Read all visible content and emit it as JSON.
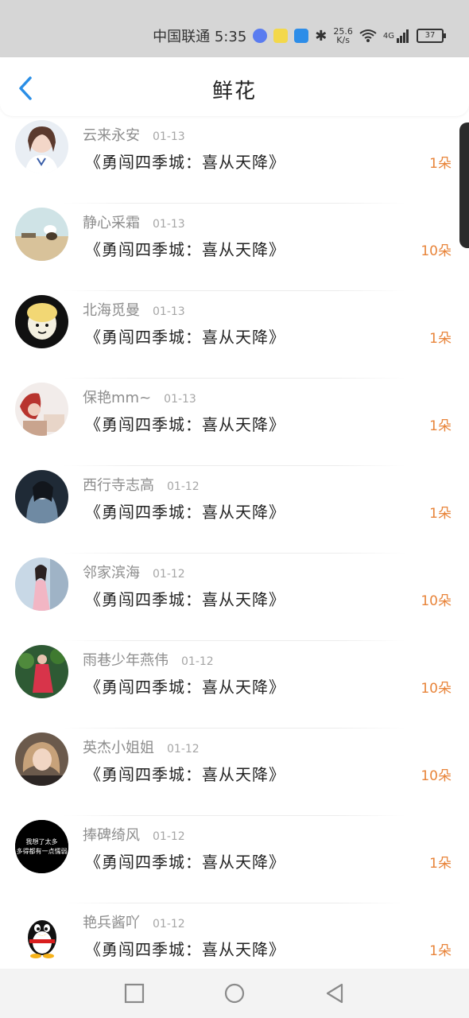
{
  "status_bar": {
    "carrier_time": "中国联通 5:35",
    "net_speed_value": "25.6",
    "net_speed_unit": "K/s",
    "network": "4G",
    "battery": "37",
    "icons": [
      "music-app-icon",
      "emoji-app-icon",
      "cloud-app-icon",
      "bluetooth-icon",
      "wifi-icon",
      "signal-icon",
      "battery-icon"
    ]
  },
  "header": {
    "title": "鲜花",
    "back_icon": "chevron-left-icon"
  },
  "colors": {
    "amount": "#e8843a",
    "back": "#2a8ee6",
    "status_bar_bg": "#d6d6d6"
  },
  "items": [
    {
      "name": "云来永安",
      "date": "01-13",
      "title": "《勇闯四季城：喜从天降》",
      "amount": "1朵"
    },
    {
      "name": "静心采霜",
      "date": "01-13",
      "title": "《勇闯四季城：喜从天降》",
      "amount": "10朵"
    },
    {
      "name": "北海觅曼",
      "date": "01-13",
      "title": "《勇闯四季城：喜从天降》",
      "amount": "1朵"
    },
    {
      "name": "保艳mm~",
      "date": "01-13",
      "title": "《勇闯四季城：喜从天降》",
      "amount": "1朵"
    },
    {
      "name": "西行寺志高",
      "date": "01-12",
      "title": "《勇闯四季城：喜从天降》",
      "amount": "1朵"
    },
    {
      "name": "邻家滨海",
      "date": "01-12",
      "title": "《勇闯四季城：喜从天降》",
      "amount": "10朵"
    },
    {
      "name": "雨巷少年燕伟",
      "date": "01-12",
      "title": "《勇闯四季城：喜从天降》",
      "amount": "10朵"
    },
    {
      "name": "英杰小姐姐",
      "date": "01-12",
      "title": "《勇闯四季城：喜从天降》",
      "amount": "10朵"
    },
    {
      "name": "捧碑绮风",
      "date": "01-12",
      "title": "《勇闯四季城：喜从天降》",
      "amount": "1朵",
      "avatar_text": "我想了太多\n多得都有一点懦弱"
    },
    {
      "name": "艳兵酱吖",
      "date": "01-12",
      "title": "《勇闯四季城：喜从天降》",
      "amount": "1朵"
    }
  ],
  "nav": {
    "icons": [
      "square-recents-icon",
      "circle-home-icon",
      "triangle-back-icon"
    ]
  }
}
